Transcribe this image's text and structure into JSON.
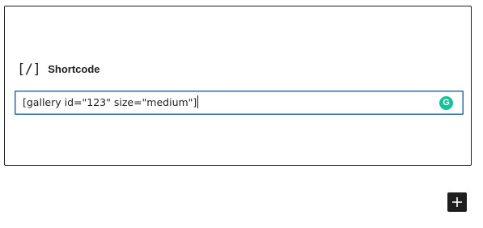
{
  "block": {
    "icon_text": "[/]",
    "title": "Shortcode",
    "input_value": "[gallery id=\"123\" size=\"medium\"]"
  },
  "grammarly": {
    "letter": "G",
    "color": "#15c39a"
  },
  "add_block": {
    "icon": "plus-icon"
  },
  "colors": {
    "input_border": "#2b6ea6",
    "frame_border": "#1e1e1e",
    "button_bg": "#1e1e1e"
  }
}
